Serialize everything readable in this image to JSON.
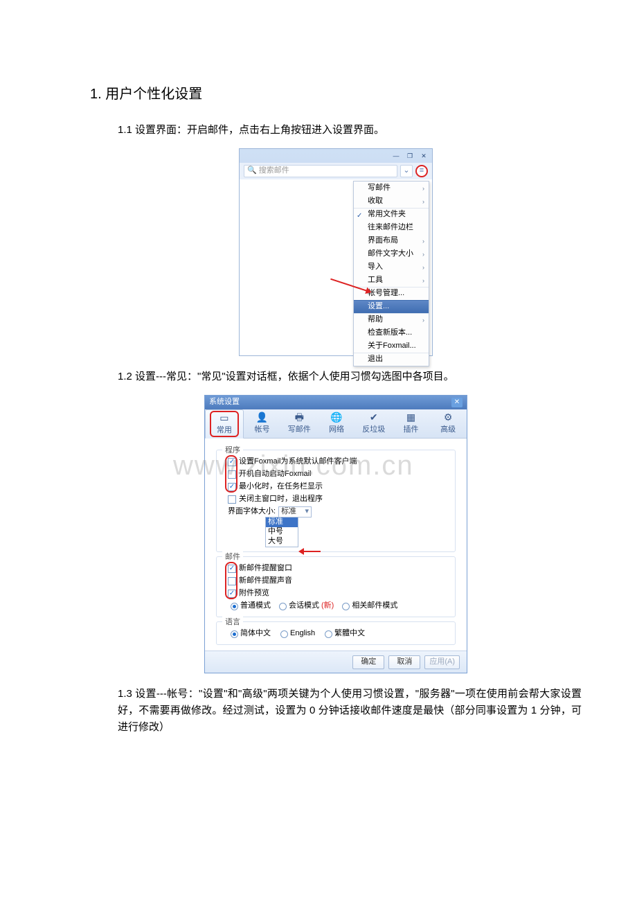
{
  "heading": "1. 用户个性化设置",
  "step1": "1.1 设置界面：开启邮件，点击右上角按钮进入设置界面。",
  "step2": "1.2 设置---常见：\"常见\"设置对话框，依据个人使用习惯勾选图中各项目。",
  "step3": "1.3 设置---帐号：\"设置\"和\"高级\"两项关键为个人使用习惯设置，\"服务器\"一项在使用前会帮大家设置好，不需要再做修改。经过测试，设置为 0 分钟话接收邮件速度是最快（部分同事设置为 1 分钟，可进行修改）",
  "watermark": "www.zixin.com.cn",
  "shot1": {
    "search_placeholder": "搜索邮件",
    "menu": [
      {
        "label": "写邮件",
        "chev": true
      },
      {
        "label": "收取",
        "chev": true,
        "sepAfter": true
      },
      {
        "label": "常用文件夹",
        "checked": true
      },
      {
        "label": "往来邮件边栏"
      },
      {
        "label": "界面布局",
        "chev": true
      },
      {
        "label": "邮件文字大小",
        "chev": true
      },
      {
        "label": "导入",
        "chev": true
      },
      {
        "label": "工具",
        "chev": true,
        "sepAfter": true
      },
      {
        "label": "帐号管理..."
      },
      {
        "label": "设置...",
        "selected": true,
        "sepAfter": true
      },
      {
        "label": "帮助",
        "chev": true
      },
      {
        "label": "检查新版本..."
      },
      {
        "label": "关于Foxmail...",
        "sepAfter": true
      },
      {
        "label": "退出"
      }
    ]
  },
  "shot2": {
    "title": "系统设置",
    "tabs": [
      {
        "label": "常用",
        "icon": "▭",
        "active": true
      },
      {
        "label": "帐号",
        "icon": "👤"
      },
      {
        "label": "写邮件",
        "icon": "🖶"
      },
      {
        "label": "网络",
        "icon": "🌐"
      },
      {
        "label": "反垃圾",
        "icon": "✔"
      },
      {
        "label": "插件",
        "icon": "▦"
      },
      {
        "label": "高级",
        "icon": "⚙"
      }
    ],
    "program_group": "程序",
    "program": [
      {
        "label": "设置Foxmail为系统默认邮件客户端",
        "checked": true
      },
      {
        "label": "开机自动启动Foxmail",
        "checked": false
      },
      {
        "label": "最小化时，在任务栏显示",
        "checked": true
      },
      {
        "label": "关闭主窗口时，退出程序",
        "checked": false
      }
    ],
    "font_label": "界面字体大小:",
    "font_value": "标准",
    "font_options": [
      "标准",
      "中号",
      "大号"
    ],
    "mail_group": "邮件",
    "mail": [
      {
        "label": "新邮件提醒窗口",
        "checked": true
      },
      {
        "label": "新邮件提醒声音",
        "checked": false
      },
      {
        "label": "附件预览",
        "checked": true
      }
    ],
    "mode": [
      {
        "label": "普通模式",
        "on": true
      },
      {
        "label": "会话模式",
        "new": "(新)"
      },
      {
        "label": "相关邮件模式"
      }
    ],
    "lang_group": "语言",
    "lang": [
      {
        "label": "简体中文",
        "on": true
      },
      {
        "label": "English"
      },
      {
        "label": "繁體中文"
      }
    ],
    "buttons": {
      "ok": "确定",
      "cancel": "取消",
      "apply": "应用(A)"
    }
  }
}
